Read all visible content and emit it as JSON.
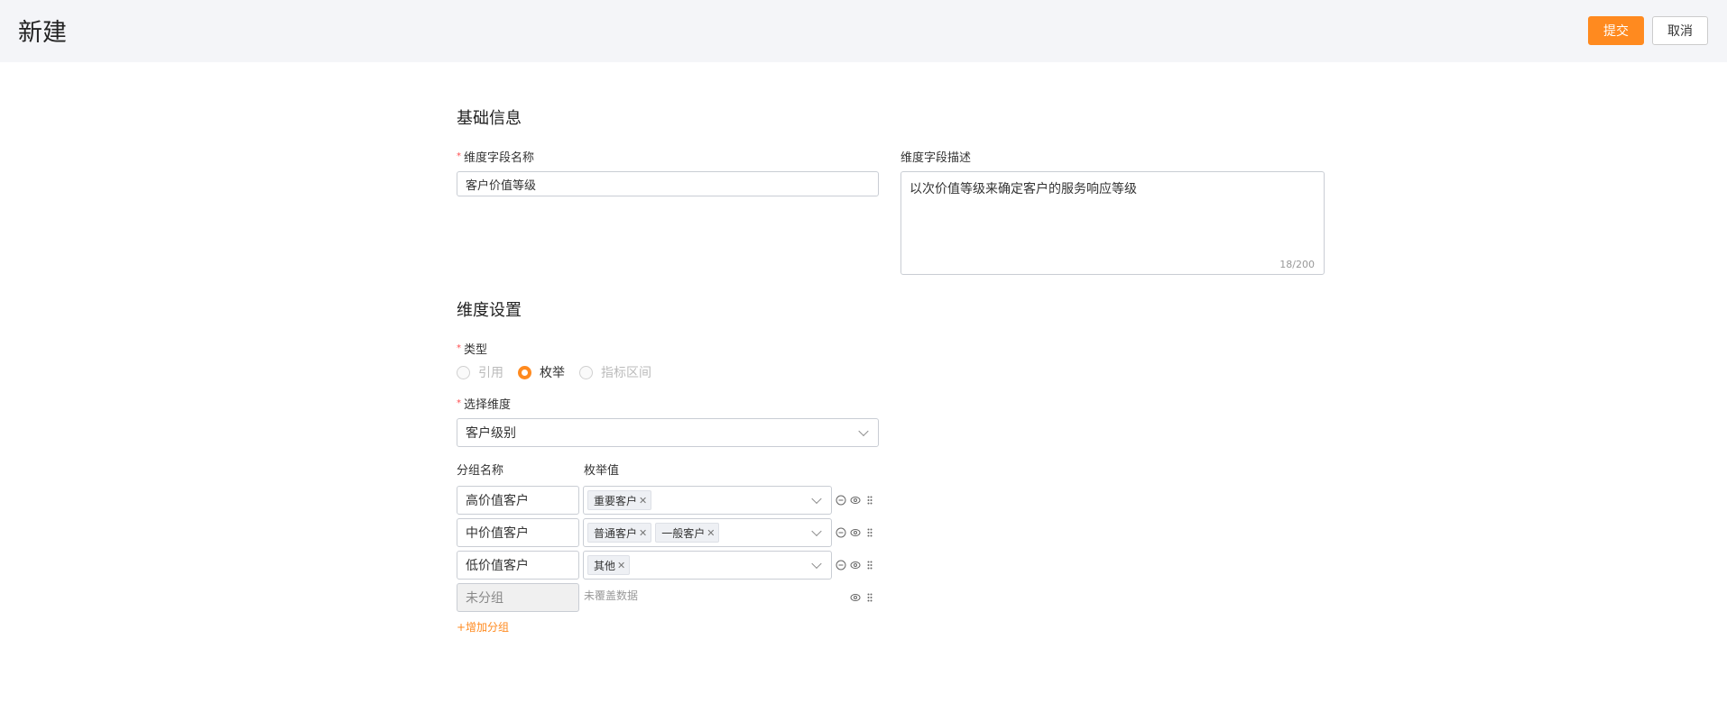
{
  "header": {
    "title": "新建",
    "submit_label": "提交",
    "cancel_label": "取消"
  },
  "basic": {
    "section_title": "基础信息",
    "name_label": "维度字段名称",
    "name_value": "客户价值等级",
    "desc_label": "维度字段描述",
    "desc_value": "以次价值等级来确定客户的服务响应等级",
    "desc_counter": "18/200"
  },
  "settings": {
    "section_title": "维度设置",
    "type_label": "类型",
    "type_options": [
      "引用",
      "枚举",
      "指标区间"
    ],
    "type_selected": "枚举",
    "dimension_label": "选择维度",
    "dimension_value": "客户级别",
    "group_name_header": "分组名称",
    "enum_value_header": "枚举值",
    "groups": [
      {
        "name": "高价值客户",
        "tags": [
          "重要客户"
        ]
      },
      {
        "name": "中价值客户",
        "tags": [
          "普通客户",
          "一般客户"
        ]
      },
      {
        "name": "低价值客户",
        "tags": [
          "其他"
        ]
      }
    ],
    "ungrouped_name": "未分组",
    "ungrouped_note": "未覆盖数据",
    "add_group_label": "+增加分组"
  },
  "icons": [
    "minus-circle-icon",
    "eye-icon",
    "drag-handle-icon",
    "close-icon",
    "chevron-down-icon"
  ],
  "colors": {
    "accent": "#ff8a1f",
    "header_bg": "#f4f5f8",
    "required": "#ff4d4f"
  }
}
